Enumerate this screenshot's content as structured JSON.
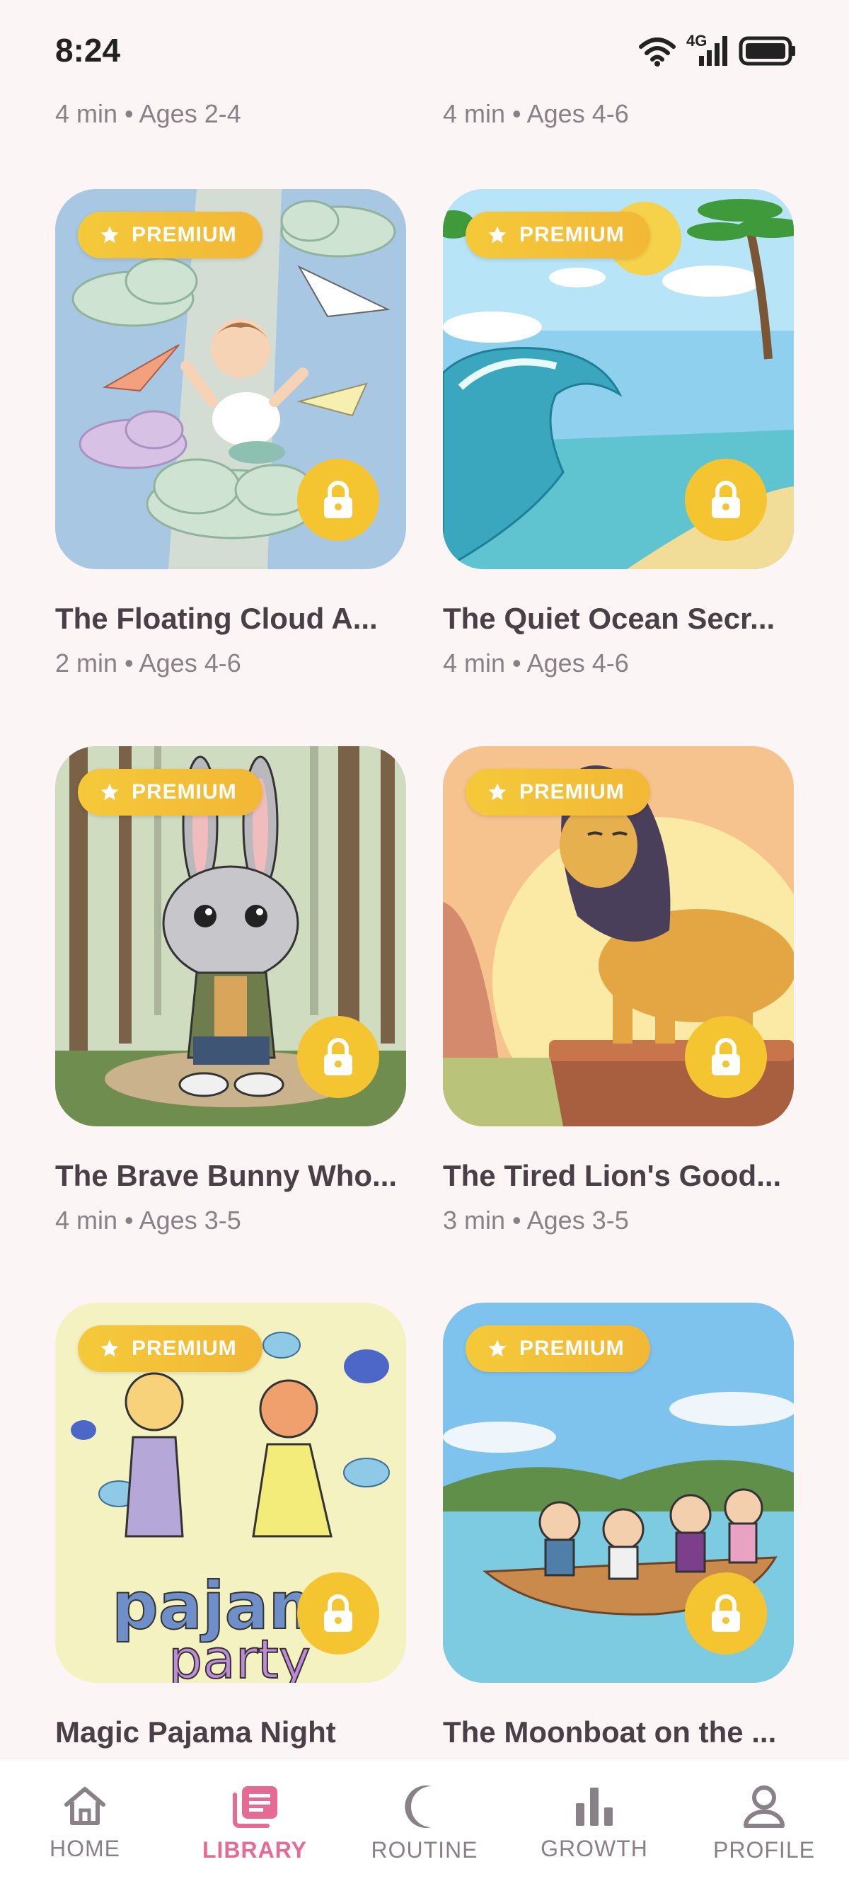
{
  "status_bar": {
    "time": "8:24",
    "network": "4G"
  },
  "top_row": [
    {
      "meta": "4 min • Ages 2-4"
    },
    {
      "meta": "4 min • Ages 4-6"
    }
  ],
  "badge_label": "PREMIUM",
  "stories": [
    {
      "title": "The Floating Cloud A...",
      "meta": "2 min • Ages 4-6",
      "premium": true,
      "locked": true
    },
    {
      "title": "The Quiet Ocean Secr...",
      "meta": "4 min • Ages 4-6",
      "premium": true,
      "locked": true
    },
    {
      "title": "The Brave Bunny Who...",
      "meta": "4 min • Ages 3-5",
      "premium": true,
      "locked": true
    },
    {
      "title": "The Tired Lion's Good...",
      "meta": "3 min • Ages 3-5",
      "premium": true,
      "locked": true
    },
    {
      "title": "Magic Pajama Night",
      "meta": "",
      "premium": true,
      "locked": true,
      "art_text": [
        "pajam",
        "party"
      ]
    },
    {
      "title": "The Moonboat on the ...",
      "meta": "",
      "premium": true,
      "locked": true
    }
  ],
  "nav": [
    {
      "label": "HOME",
      "icon": "home-icon",
      "active": false
    },
    {
      "label": "LIBRARY",
      "icon": "library-icon",
      "active": true
    },
    {
      "label": "ROUTINE",
      "icon": "moon-icon",
      "active": false
    },
    {
      "label": "GROWTH",
      "icon": "bar-chart-icon",
      "active": false
    },
    {
      "label": "PROFILE",
      "icon": "user-icon",
      "active": false
    }
  ],
  "colors": {
    "accent": "#e56b95",
    "premium": "#f5c531",
    "background": "#fcf5f5"
  }
}
